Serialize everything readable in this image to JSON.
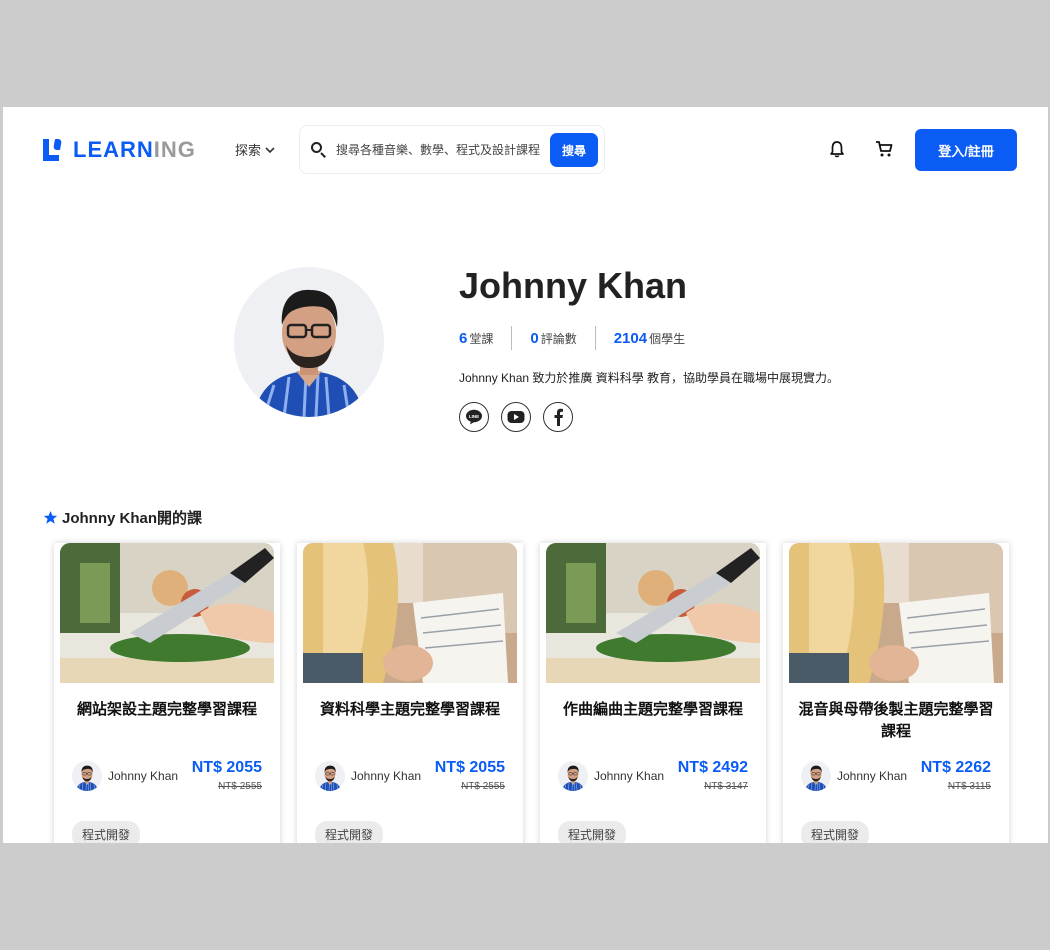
{
  "header": {
    "logo_text_a": "LEARN",
    "logo_text_b": "ING",
    "explore_label": "探索",
    "search_placeholder": "搜尋各種音樂、數學、程式及設計課程",
    "search_button": "搜尋",
    "login_button": "登入/註冊"
  },
  "profile": {
    "name": "Johnny Khan",
    "stats": [
      {
        "value": "6",
        "label": "堂課"
      },
      {
        "value": "0",
        "label": "評論數"
      },
      {
        "value": "2104",
        "label": "個學生"
      }
    ],
    "bio": "Johnny Khan 致力於推廣 資料科學 教育，協助學員在職場中展現實力。",
    "socials": [
      "line-icon",
      "youtube-icon",
      "facebook-icon"
    ]
  },
  "courses_section": {
    "title": "Johnny Khan開的課"
  },
  "courses": [
    {
      "title": "網站架設主題完整學習課程",
      "author": "Johnny Khan",
      "price": "NT$ 2055",
      "original_price": "NT$ 2555",
      "tag": "程式開發",
      "image": "cooking"
    },
    {
      "title": "資料科學主題完整學習課程",
      "author": "Johnny Khan",
      "price": "NT$ 2055",
      "original_price": "NT$ 2555",
      "tag": "程式開發",
      "image": "writing"
    },
    {
      "title": "作曲編曲主題完整學習課程",
      "author": "Johnny Khan",
      "price": "NT$ 2492",
      "original_price": "NT$ 3147",
      "tag": "程式開發",
      "image": "cooking"
    },
    {
      "title": "混音與母帶後製主題完整學習課程",
      "author": "Johnny Khan",
      "price": "NT$ 2262",
      "original_price": "NT$ 3115",
      "tag": "程式開發",
      "image": "writing"
    }
  ],
  "colors": {
    "accent": "#0a5cf5",
    "page_bg": "#cccccc",
    "card_bg": "#ffffff"
  }
}
